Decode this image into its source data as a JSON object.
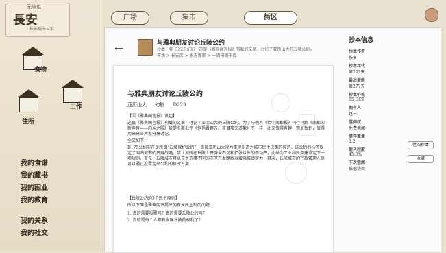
{
  "app": {
    "logo_top": "元故也",
    "logo_title": "長安",
    "logo_sub": "长安城市自治",
    "top_tabs": [
      {
        "label": "广场"
      },
      {
        "label": "集市"
      },
      {
        "label": "街区"
      }
    ],
    "active_tab": 2
  },
  "map": {
    "labels": [
      {
        "text": "食物"
      },
      {
        "text": "工作"
      },
      {
        "text": "住所"
      }
    ]
  },
  "sidebar_nav": [
    {
      "label": "我的食谱"
    },
    {
      "label": "我的藏书"
    },
    {
      "label": "我的困业"
    },
    {
      "label": "我的教育"
    },
    {
      "label": "我的关系"
    },
    {
      "label": "我的社交"
    }
  ],
  "book": {
    "title": "与雅典朋友讨论丘陵公约",
    "meta": "抄本 · 卷 D223 幻影 · 这是《雅典闻言报》刊载的文章，讨论了亚历山大的丘陵公约。",
    "breadcrumb": "市场 > 长安库 > 永吉阁家 > 一周书阁书库",
    "doc_title": "与雅典朋友讨论丘陵公约",
    "doc_meta_author": "亚历山大",
    "doc_meta_label": "幻影",
    "doc_meta_code": "D223",
    "p1": "【因《雅典闻言报》讯起】",
    "p2": "这篇《雅典闻言报》刊载的文章，讨论了亚历山大的丘陵公约。为了与他人《恰中南都报》刊行刊翻《南都的新声音——内斗之殿》被提多斯批评《包括晋野方、攻目攻文道歉》不一样，此文值得有趣，观点独到，值得用来来当大家分享讨论。",
    "p3": "全文如下：",
    "p4": "D175公约实在是所谓“丘陵保护公约”一直被亚历山大视为重建乐道为城市民主决策的典范，该公约的标签规定了国内城市的开展战略，禁止城所在丘陵上开辟采石场和扩张以外的不动产，此举为工业和民用建设定下一项规则。首先，丘陵城市可以自主选择不同的市区开发路线以增强城镇实力；其次，丘陵城市的行政管理人员可以通过投票定出公约的修改方案……",
    "p5": "【丘陵公约的3个民主原则】",
    "p6": "所以下面是雅典朋友提出的有关民主制的问题：",
    "p7": "1. 真的需要投票吗？真的需要丘陵公约吗？",
    "p8": "2. 真的是每个人都有发展丘陵的权利了？"
  },
  "info_panel": {
    "title": "抄本信息",
    "fields": [
      {
        "k": "抄本作者",
        "v": "佚名"
      },
      {
        "k": "抄本年代",
        "v": "第223天"
      },
      {
        "k": "最后更新",
        "v": "第277天"
      },
      {
        "k": "抄本价格",
        "v": "55 DCT"
      },
      {
        "k": "拥有人",
        "v": "赵一"
      },
      {
        "k": "借阅权",
        "v": "免费借阅"
      },
      {
        "k": "借存重量",
        "v": "0.2"
      },
      {
        "k": "耐久程度",
        "v": "45.0%"
      },
      {
        "k": "下次借阅",
        "v": "依据协商"
      }
    ],
    "btn1": "借阅抄本",
    "btn2": "收藏"
  }
}
